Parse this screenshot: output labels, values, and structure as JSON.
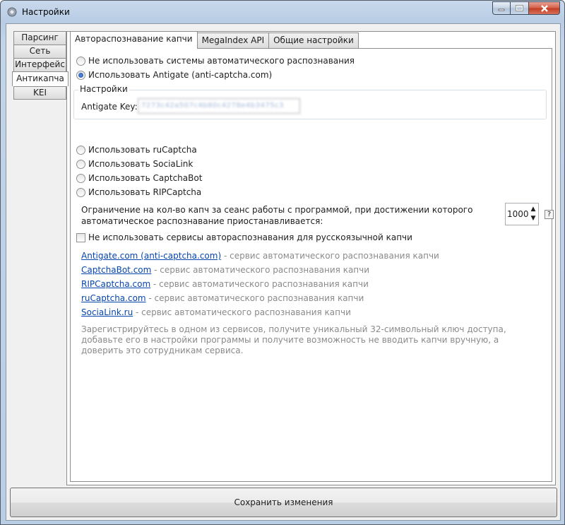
{
  "window": {
    "title": "Настройки"
  },
  "side_tabs": [
    "Парсинг",
    "Сеть",
    "Интерфейс",
    "Антикапча",
    "KEI"
  ],
  "top_tabs": [
    "Автораспознавание капчи",
    "MegaIndex API",
    "Общие настройки"
  ],
  "options": {
    "no_auto": "Не использовать системы автоматического распознавания",
    "antigate": "Использовать Antigate (anti-captcha.com)",
    "rucaptcha": "Использовать ruCaptcha",
    "socialink": "Использовать SociaLink",
    "captchabot": "Использовать CaptchaBot",
    "ripcaptcha": "Использовать RIPCaptcha"
  },
  "settings_group": {
    "title": "Настройки",
    "key_label": "Antigate Key:",
    "key_value": "7273c42a507c4b80c4278e4b3475c3"
  },
  "limit": {
    "text": "Ограничение на кол-во капч за сеанс работы с программой, при достижении которого автоматическое распознавание приостанавливается:",
    "value": "1000",
    "help": "?"
  },
  "russian_captcha": "Не использовать сервисы автораспознавания для русскоязычной капчи",
  "services": [
    {
      "name": "Antigate.com (anti-captcha.com)",
      "desc": " - сервис автоматического распознавания капчи"
    },
    {
      "name": "CaptchaBot.com",
      "desc": " - сервис автоматического распознавания капчи"
    },
    {
      "name": "RIPCaptcha.com",
      "desc": " - сервис автоматического распознавания капчи"
    },
    {
      "name": "ruCaptcha.com",
      "desc": " - сервис автоматического распознавания капчи"
    },
    {
      "name": "SociaLink.ru",
      "desc": " - сервис автоматического распознавания капчи"
    }
  ],
  "register_text": "Зарегистрируйтесь в одном из сервисов, получите уникальный 32-символьный ключ доступа, добавьте его в настройки программы и получите возможность не вводить капчи вручную, а доверить это сотрудникам сервиса.",
  "save_label": "Сохранить изменения"
}
